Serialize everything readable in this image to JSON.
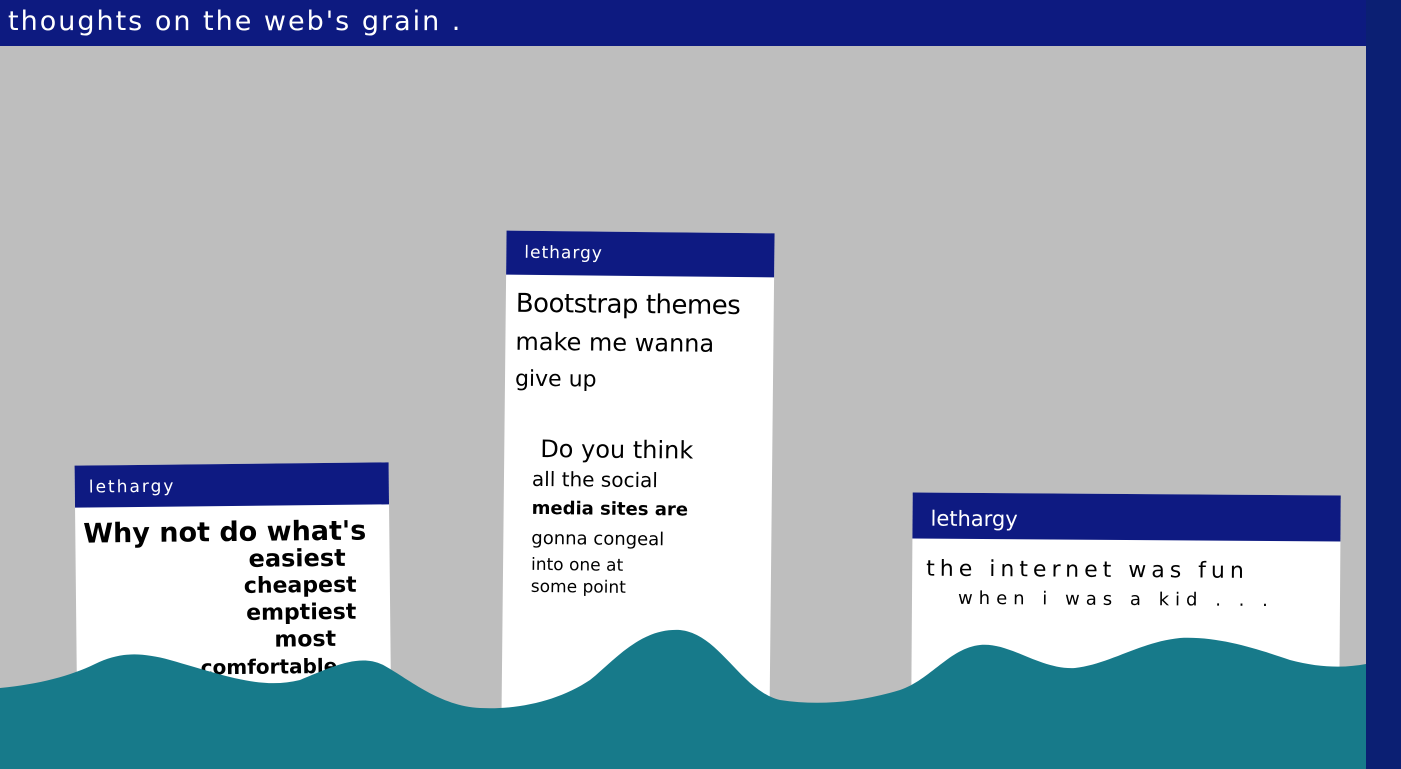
{
  "header": {
    "title": "thoughts on the web's grain ."
  },
  "colors": {
    "header_bg": "#0d1a80",
    "page_bg": "#bebebe",
    "wave": "#177a8a",
    "strip": "#0b1f73"
  },
  "cards": [
    {
      "tag": "lethargy",
      "lines": [
        "Why not do what's",
        "easiest",
        "cheapest",
        "emptiest",
        "most",
        "comfortable"
      ]
    },
    {
      "tag": "lethargy",
      "lines_a": [
        "Bootstrap themes",
        "make me wanna",
        "give up"
      ],
      "lines_b": [
        "Do you think",
        "all the social",
        "media sites are",
        "gonna congeal",
        "into one at",
        "some point"
      ]
    },
    {
      "tag": "lethargy",
      "lines": [
        "the internet was fun",
        "when i was a kid . . ."
      ]
    }
  ]
}
